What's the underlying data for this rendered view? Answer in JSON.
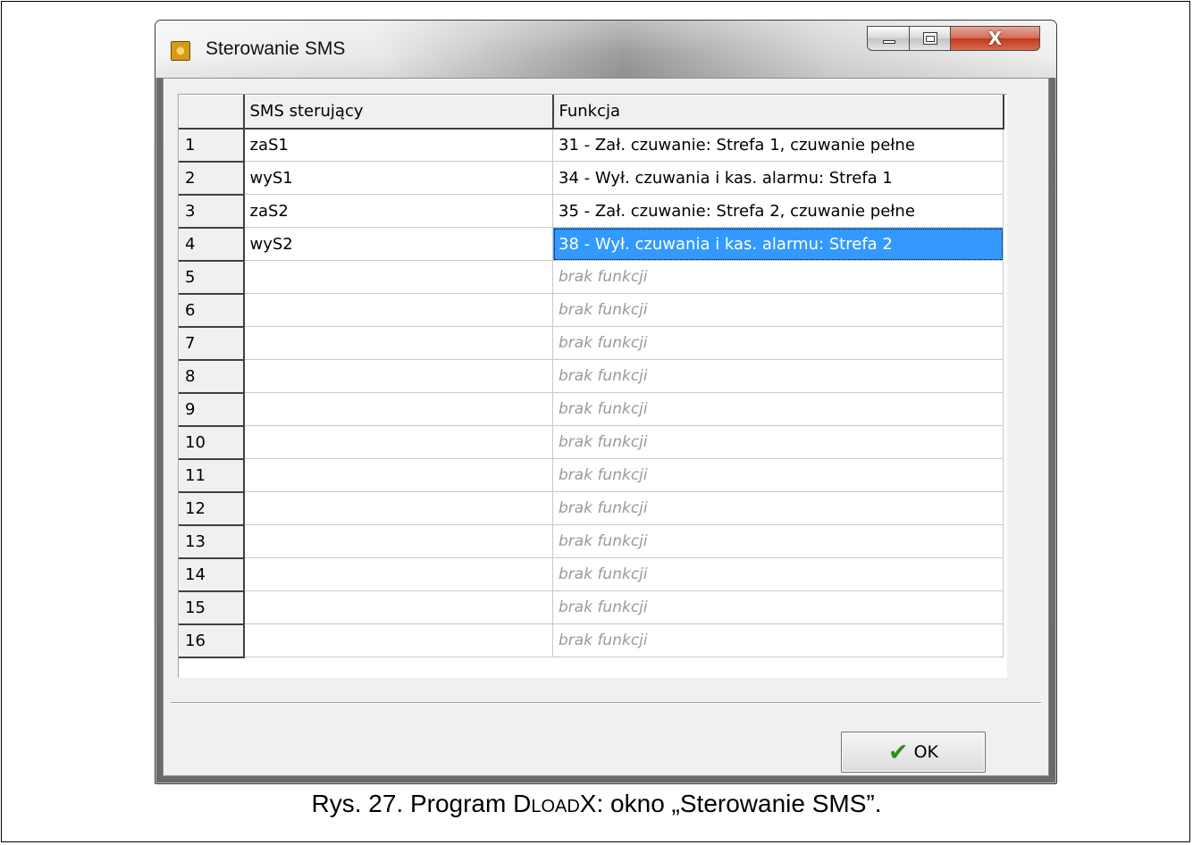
{
  "window": {
    "title": "Sterowanie SMS",
    "minimize_icon": "minimize-icon",
    "maximize_icon": "maximize-icon",
    "close_icon": "close-icon",
    "close_glyph": "X"
  },
  "grid": {
    "columns": [
      "",
      "SMS sterujący",
      "Funkcja"
    ],
    "selected_row": 4,
    "rows": [
      {
        "num": "1",
        "sms": "zaS1",
        "func": "31 - Zał. czuwanie: Strefa  1, czuwanie pełne",
        "empty": false
      },
      {
        "num": "2",
        "sms": "wyS1",
        "func": "34 - Wył. czuwania i kas. alarmu: Strefa  1",
        "empty": false
      },
      {
        "num": "3",
        "sms": "zaS2",
        "func": "35 - Zał. czuwanie: Strefa  2, czuwanie pełne",
        "empty": false
      },
      {
        "num": "4",
        "sms": "wyS2",
        "func": "38 - Wył. czuwania i kas. alarmu: Strefa  2",
        "empty": false
      },
      {
        "num": "5",
        "sms": "",
        "func": "brak funkcji",
        "empty": true
      },
      {
        "num": "6",
        "sms": "",
        "func": "brak funkcji",
        "empty": true
      },
      {
        "num": "7",
        "sms": "",
        "func": "brak funkcji",
        "empty": true
      },
      {
        "num": "8",
        "sms": "",
        "func": "brak funkcji",
        "empty": true
      },
      {
        "num": "9",
        "sms": "",
        "func": "brak funkcji",
        "empty": true
      },
      {
        "num": "10",
        "sms": "",
        "func": "brak funkcji",
        "empty": true
      },
      {
        "num": "11",
        "sms": "",
        "func": "brak funkcji",
        "empty": true
      },
      {
        "num": "12",
        "sms": "",
        "func": "brak funkcji",
        "empty": true
      },
      {
        "num": "13",
        "sms": "",
        "func": "brak funkcji",
        "empty": true
      },
      {
        "num": "14",
        "sms": "",
        "func": "brak funkcji",
        "empty": true
      },
      {
        "num": "15",
        "sms": "",
        "func": "brak funkcji",
        "empty": true
      },
      {
        "num": "16",
        "sms": "",
        "func": "brak funkcji",
        "empty": true
      }
    ]
  },
  "buttons": {
    "ok_label": "OK",
    "ok_icon": "checkmark-icon"
  },
  "caption": {
    "prefix": "Rys. 27. Program ",
    "program_name": "DloadX",
    "suffix": ": okno „Sterowanie SMS”."
  }
}
